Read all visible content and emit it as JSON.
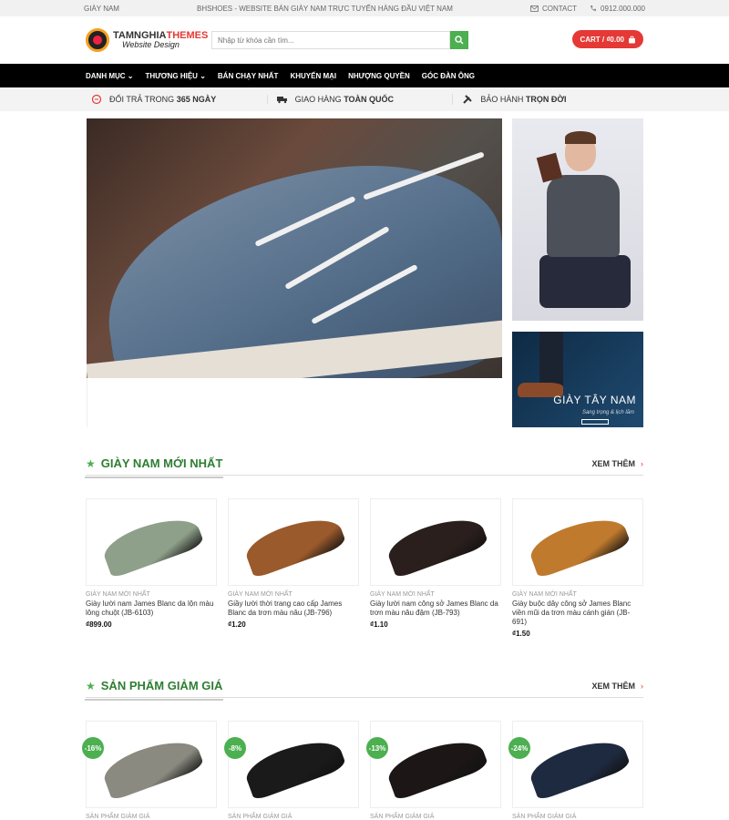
{
  "topbar": {
    "left": "GIÀY NAM",
    "center": "BHSHOES - WEBSITE BÁN GIÀY NAM TRỰC TUYẾN HÀNG ĐẦU VIỆT NAM",
    "contact": "CONTACT",
    "phone": "0912.000.000"
  },
  "header": {
    "logo_text_plain": "TAMNGHIA",
    "logo_text_accent": "THEMES",
    "logo_tagline": "Website Design",
    "search_placeholder": "Nhập từ khóa cần tìm...",
    "cart_label": "CART / ₫0.00"
  },
  "nav": {
    "items": [
      "DANH MỤC",
      "THƯƠNG HIỆU",
      "BÁN CHẠY NHẤT",
      "KHUYẾN MẠI",
      "NHƯỢNG QUYỀN",
      "GÓC ĐÀN ÔNG"
    ]
  },
  "benefits": [
    {
      "prefix": "ĐỔI TRẢ TRONG ",
      "bold": "365 NGÀY"
    },
    {
      "prefix": "GIAO HÀNG ",
      "bold": "TOÀN QUỐC"
    },
    {
      "prefix": "BẢO HÀNH ",
      "bold": "TRỌN ĐỜI"
    }
  ],
  "banner_side": {
    "title": "GIÀY TÂY NAM",
    "subtitle": "Sang trọng & lịch lãm"
  },
  "section_new": {
    "title": "GIÀY NAM MỚI NHẤT",
    "more": "XEM THÊM",
    "products": [
      {
        "category": "GIÀY NAM MỚI NHẤT",
        "name": "Giày lười nam James Blanc da lộn màu lông chuột (JB-6103)",
        "price": "₫899.00",
        "color": "#8fa08a"
      },
      {
        "category": "GIÀY NAM MỚI NHẤT",
        "name": "Giầy lười thời trang cao cấp James Blanc da trơn màu nâu (JB-796)",
        "price": "₫1.20",
        "color": "#9a5a2c"
      },
      {
        "category": "GIÀY NAM MỚI NHẤT",
        "name": "Giày lười nam công sở James Blanc da trơn màu nâu đậm (JB-793)",
        "price": "₫1.10",
        "color": "#2a1f1c"
      },
      {
        "category": "GIÀY NAM MỚI NHẤT",
        "name": "Giày buộc dây công sở James Blanc viền mũi da trơn màu cánh gián (JB-691)",
        "price": "₫1.50",
        "color": "#c07a2e"
      }
    ]
  },
  "section_sale": {
    "title": "SẢN PHẨM GIẢM GIÁ",
    "more": "XEM THÊM",
    "products": [
      {
        "badge": "-16%",
        "category": "SẢN PHẨM GIẢM GIÁ",
        "color": "#8a8a80"
      },
      {
        "badge": "-8%",
        "category": "SẢN PHẨM GIẢM GIÁ",
        "color": "#1a1a1a"
      },
      {
        "badge": "-13%",
        "category": "SẢN PHẨM GIẢM GIÁ",
        "color": "#1c1616"
      },
      {
        "badge": "-24%",
        "category": "SẢN PHẨM GIẢM GIÁ",
        "color": "#1e2a40"
      }
    ]
  }
}
